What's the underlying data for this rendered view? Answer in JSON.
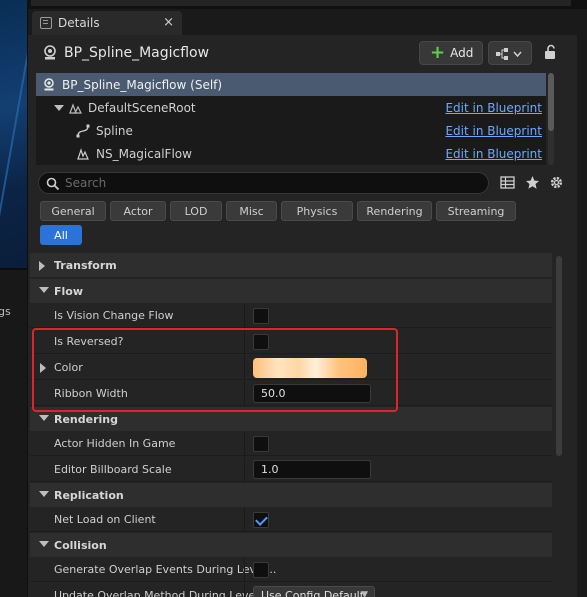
{
  "left_strip": {
    "fragment": "gs"
  },
  "tab": {
    "label": "Details",
    "close": "×",
    "icon": "details-icon"
  },
  "header": {
    "title": "BP_Spline_Magicflow",
    "add_label": "Add",
    "icons": [
      "actor-icon",
      "hierarchy-icon",
      "lock-icon"
    ]
  },
  "tree": {
    "rows": [
      {
        "label": "BP_Spline_Magicflow (Self)",
        "link": ""
      },
      {
        "label": "DefaultSceneRoot",
        "link": "Edit in Blueprint"
      },
      {
        "label": "Spline",
        "link": "Edit in Blueprint"
      },
      {
        "label": "NS_MagicalFlow",
        "link": "Edit in Blueprint"
      }
    ]
  },
  "search": {
    "placeholder": "Search",
    "value": ""
  },
  "filters": [
    "General",
    "Actor",
    "LOD",
    "Misc",
    "Physics",
    "Rendering",
    "Streaming",
    "All"
  ],
  "filter_active": "All",
  "details": {
    "transform": "Transform",
    "flow": "Flow",
    "is_vision_change_flow": "Is Vision Change Flow",
    "is_reversed": "Is Reversed?",
    "color": "Color",
    "ribbon_width": "Ribbon Width",
    "ribbon_width_value": "50.0",
    "rendering": "Rendering",
    "actor_hidden_in_game": "Actor Hidden In Game",
    "editor_billboard_scale": "Editor Billboard Scale",
    "editor_billboard_scale_value": "1.0",
    "replication": "Replication",
    "net_load_on_client": "Net Load on Client",
    "net_load_on_client_checked": true,
    "collision": "Collision",
    "generate_overlap": "Generate Overlap Events During Level...",
    "update_overlap": "Update Overlap Method During Level...",
    "update_overlap_value": "Use Config Default"
  },
  "colors": {
    "accent": "#2b73d6",
    "link": "#6fa8ff",
    "highlight": "#e0232f",
    "selected_row": "#4a5a70"
  }
}
